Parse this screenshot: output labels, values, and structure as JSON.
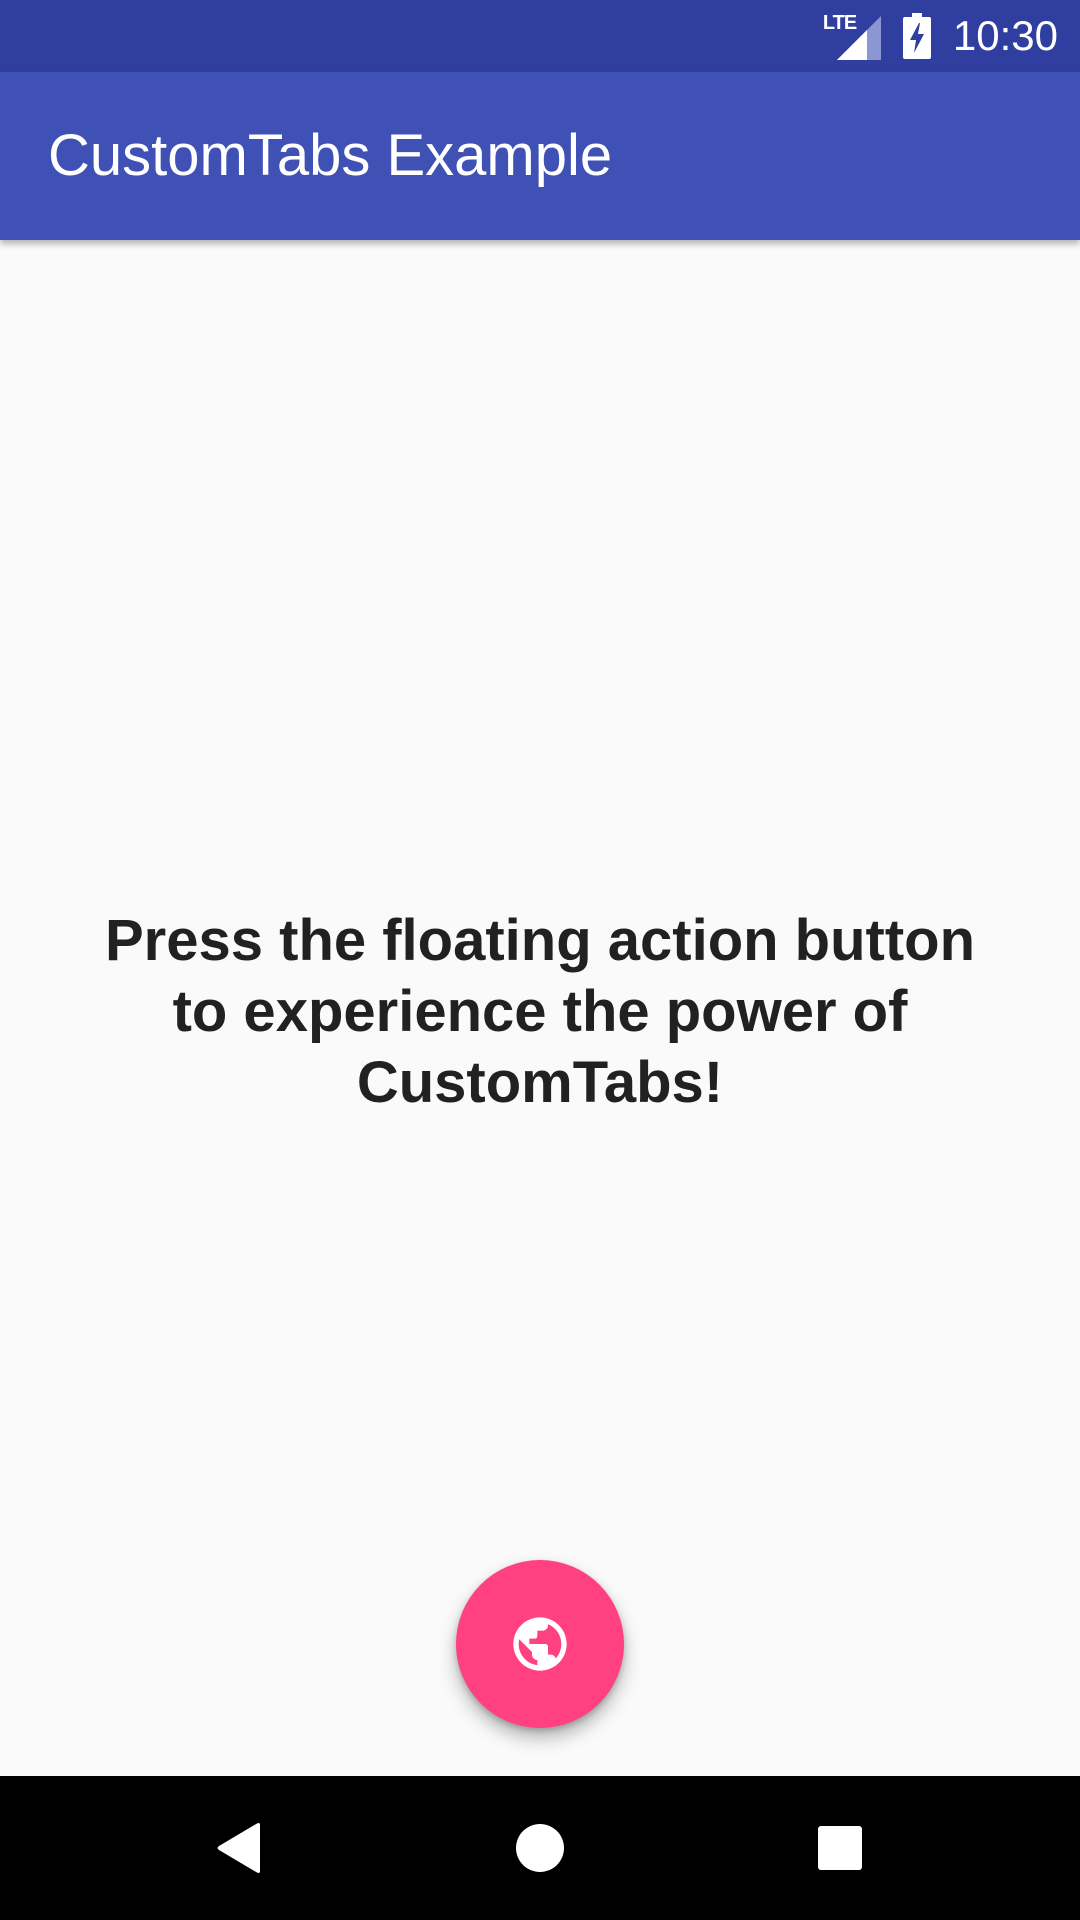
{
  "status_bar": {
    "network_label": "LTE",
    "time": "10:30",
    "icons": [
      "lte-signal-icon",
      "battery-charging-icon"
    ],
    "background_color": "#303F9F"
  },
  "app_bar": {
    "title": "CustomTabs Example",
    "background_color": "#3F51B5"
  },
  "main": {
    "message": "Press the floating action button to experience the power of CustomTabs!"
  },
  "fab": {
    "icon": "globe-icon",
    "color": "#FF4081"
  },
  "nav_bar": {
    "buttons": [
      "back-icon",
      "home-icon",
      "recents-icon"
    ]
  }
}
